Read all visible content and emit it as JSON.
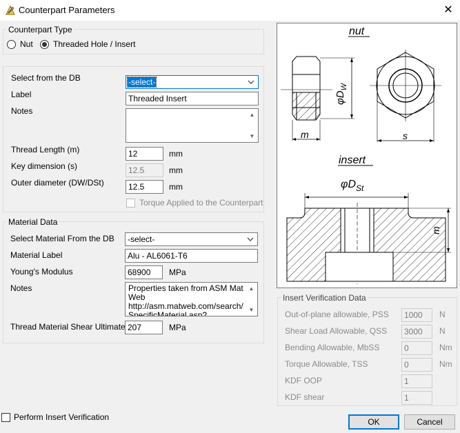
{
  "window": {
    "title": "Counterpart Parameters",
    "close_glyph": "✕"
  },
  "counterpart_type": {
    "legend": "Counterpart Type",
    "options": [
      {
        "label": "Nut",
        "selected": false
      },
      {
        "label": "Threaded Hole / Insert",
        "selected": true
      }
    ]
  },
  "counterpart": {
    "select_db_label": "Select from the DB",
    "select_db_value": "-select-",
    "label_label": "Label",
    "label_value": "Threaded Insert",
    "notes_label": "Notes",
    "notes_value": "",
    "thread_length_label": "Thread Length (m)",
    "thread_length_value": "12",
    "thread_length_unit": "mm",
    "key_dim_label": "Key dimension (s)",
    "key_dim_value": "12.5",
    "key_dim_unit": "mm",
    "outer_diam_label": "Outer diameter (DW/DSt)",
    "outer_diam_value": "12.5",
    "outer_diam_unit": "mm",
    "torque_applied_label": "Torque Applied to the Counterpart"
  },
  "material": {
    "legend": "Material Data",
    "select_label": "Select Material From the DB",
    "select_value": "-select-",
    "label_label": "Material Label",
    "label_value": "Alu - AL6061-T6",
    "youngs_label": "Young's Modulus",
    "youngs_value": "68900",
    "youngs_unit": "MPa",
    "notes_label": "Notes",
    "notes_value": "Properties taken from ASM MatWeb\nhttp://asm.matweb.com/search/SpecificMaterial.asp?",
    "shear_label": "Thread Material Shear Ultimate",
    "shear_value": "207",
    "shear_unit": "MPa"
  },
  "figure": {
    "nut_title": "nut",
    "insert_title": "insert",
    "dw_label": "φD",
    "dw_sub": "W",
    "m_label": "m",
    "s_label": "s",
    "dst_label": "φD",
    "dst_sub": "St",
    "m2_label": "m"
  },
  "verification": {
    "legend": "Insert Verification Data",
    "rows": [
      {
        "label": "Out-of-plane allowable, PSS",
        "value": "1000",
        "unit": "N"
      },
      {
        "label": "Shear Load Allowable, QSS",
        "value": "3000",
        "unit": "N"
      },
      {
        "label": "Bending Allowable, MbSS",
        "value": "0",
        "unit": "Nm"
      },
      {
        "label": "Torque Allowable, TSS",
        "value": "0",
        "unit": "Nm"
      },
      {
        "label": "KDF OOP",
        "value": "1",
        "unit": ""
      },
      {
        "label": "KDF shear",
        "value": "1",
        "unit": ""
      }
    ],
    "perform_label": "Perform Insert Verification"
  },
  "buttons": {
    "ok": "OK",
    "cancel": "Cancel"
  }
}
